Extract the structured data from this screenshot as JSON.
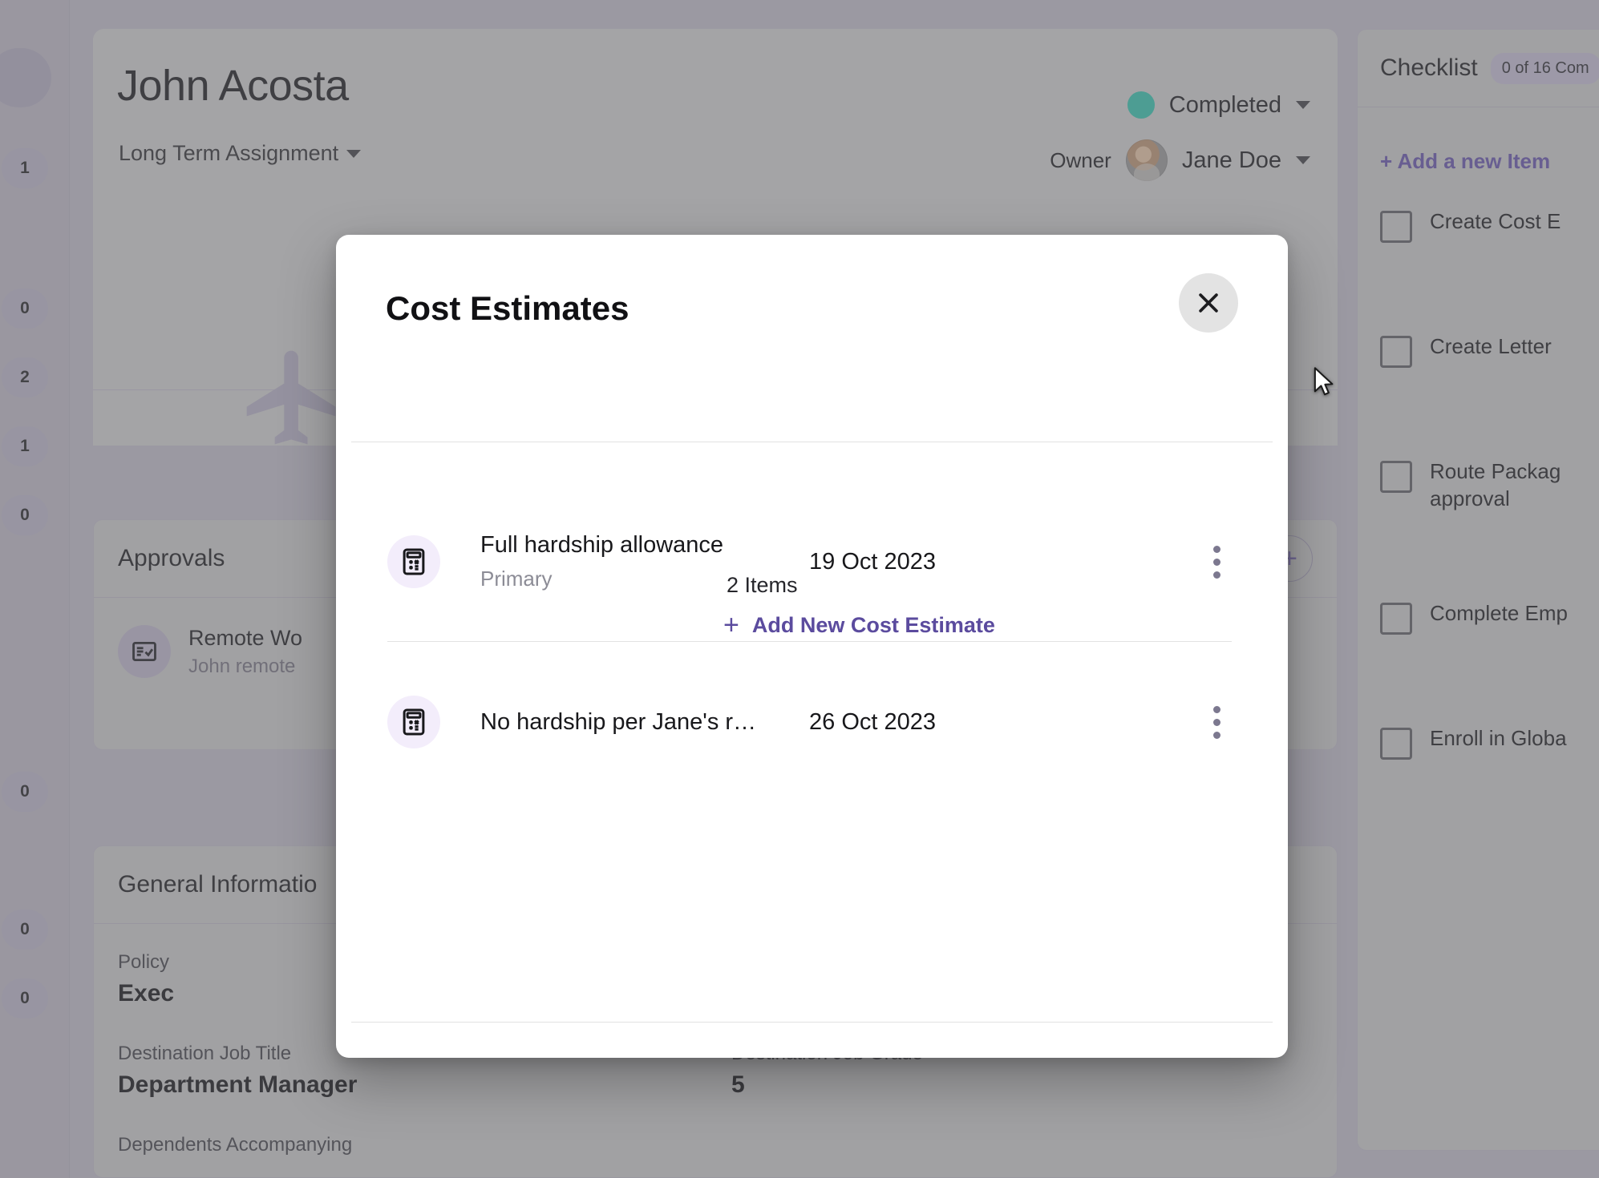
{
  "theme": {
    "accent_purple": "#5b4b9e",
    "status_teal": "#2fb8a4",
    "icon_bg": "#f3edfb",
    "modal_bg": "#ffffff"
  },
  "left_rail": {
    "badges": [
      "",
      "1",
      "0",
      "2",
      "1",
      "0",
      "0",
      "0",
      "0"
    ]
  },
  "header": {
    "title": "John Acosta",
    "assignment_type": "Long Term Assignment",
    "assignment_caret": "chevron-down-icon",
    "status": "Completed",
    "status_caret": "chevron-down-icon",
    "owner_label": "Owner",
    "owner_name": "Jane Doe",
    "owner_caret": "chevron-down-icon",
    "watermark": "airplane-icon"
  },
  "approvals": {
    "title": "Approvals",
    "add_label": "+",
    "items": [
      {
        "icon": "approval-list-icon",
        "title": "Remote Wo",
        "subtitle": "John remote"
      }
    ]
  },
  "general_information": {
    "title": "General Informatio",
    "fields": [
      {
        "label": "Policy",
        "value": "Exec"
      },
      {
        "label": "Destination Job Title",
        "value": "Department Manager"
      },
      {
        "label": "Destination Job Grade",
        "value": "5"
      },
      {
        "label": "Dependents Accompanying",
        "value": ""
      }
    ]
  },
  "checklist": {
    "title": "Checklist",
    "progress_badge": "0 of 16 Com",
    "add_item_label": "+ Add a new Item",
    "items": [
      {
        "label": "Create Cost E",
        "checked": false
      },
      {
        "label": "Create Letter ",
        "checked": false
      },
      {
        "label": "Route Packag\napproval",
        "checked": false
      },
      {
        "label": "Complete Emp",
        "checked": false
      },
      {
        "label": "Enroll in Globa",
        "checked": false
      }
    ]
  },
  "modal": {
    "title": "Cost Estimates",
    "close_icon": "close-icon",
    "item_count_label": "2 Items",
    "add_label": "Add New Cost Estimate",
    "add_icon": "plus-icon",
    "rows": [
      {
        "icon": "calculator-icon",
        "name": "Full hardship allowance",
        "subtitle": "Primary",
        "date": "19 Oct 2023",
        "menu_icon": "kebab-menu-icon"
      },
      {
        "icon": "calculator-icon",
        "name": "No hardship per Jane's r…",
        "subtitle": "",
        "date": "26 Oct 2023",
        "menu_icon": "kebab-menu-icon"
      }
    ]
  },
  "cursor": {
    "icon": "mouse-pointer-icon"
  }
}
